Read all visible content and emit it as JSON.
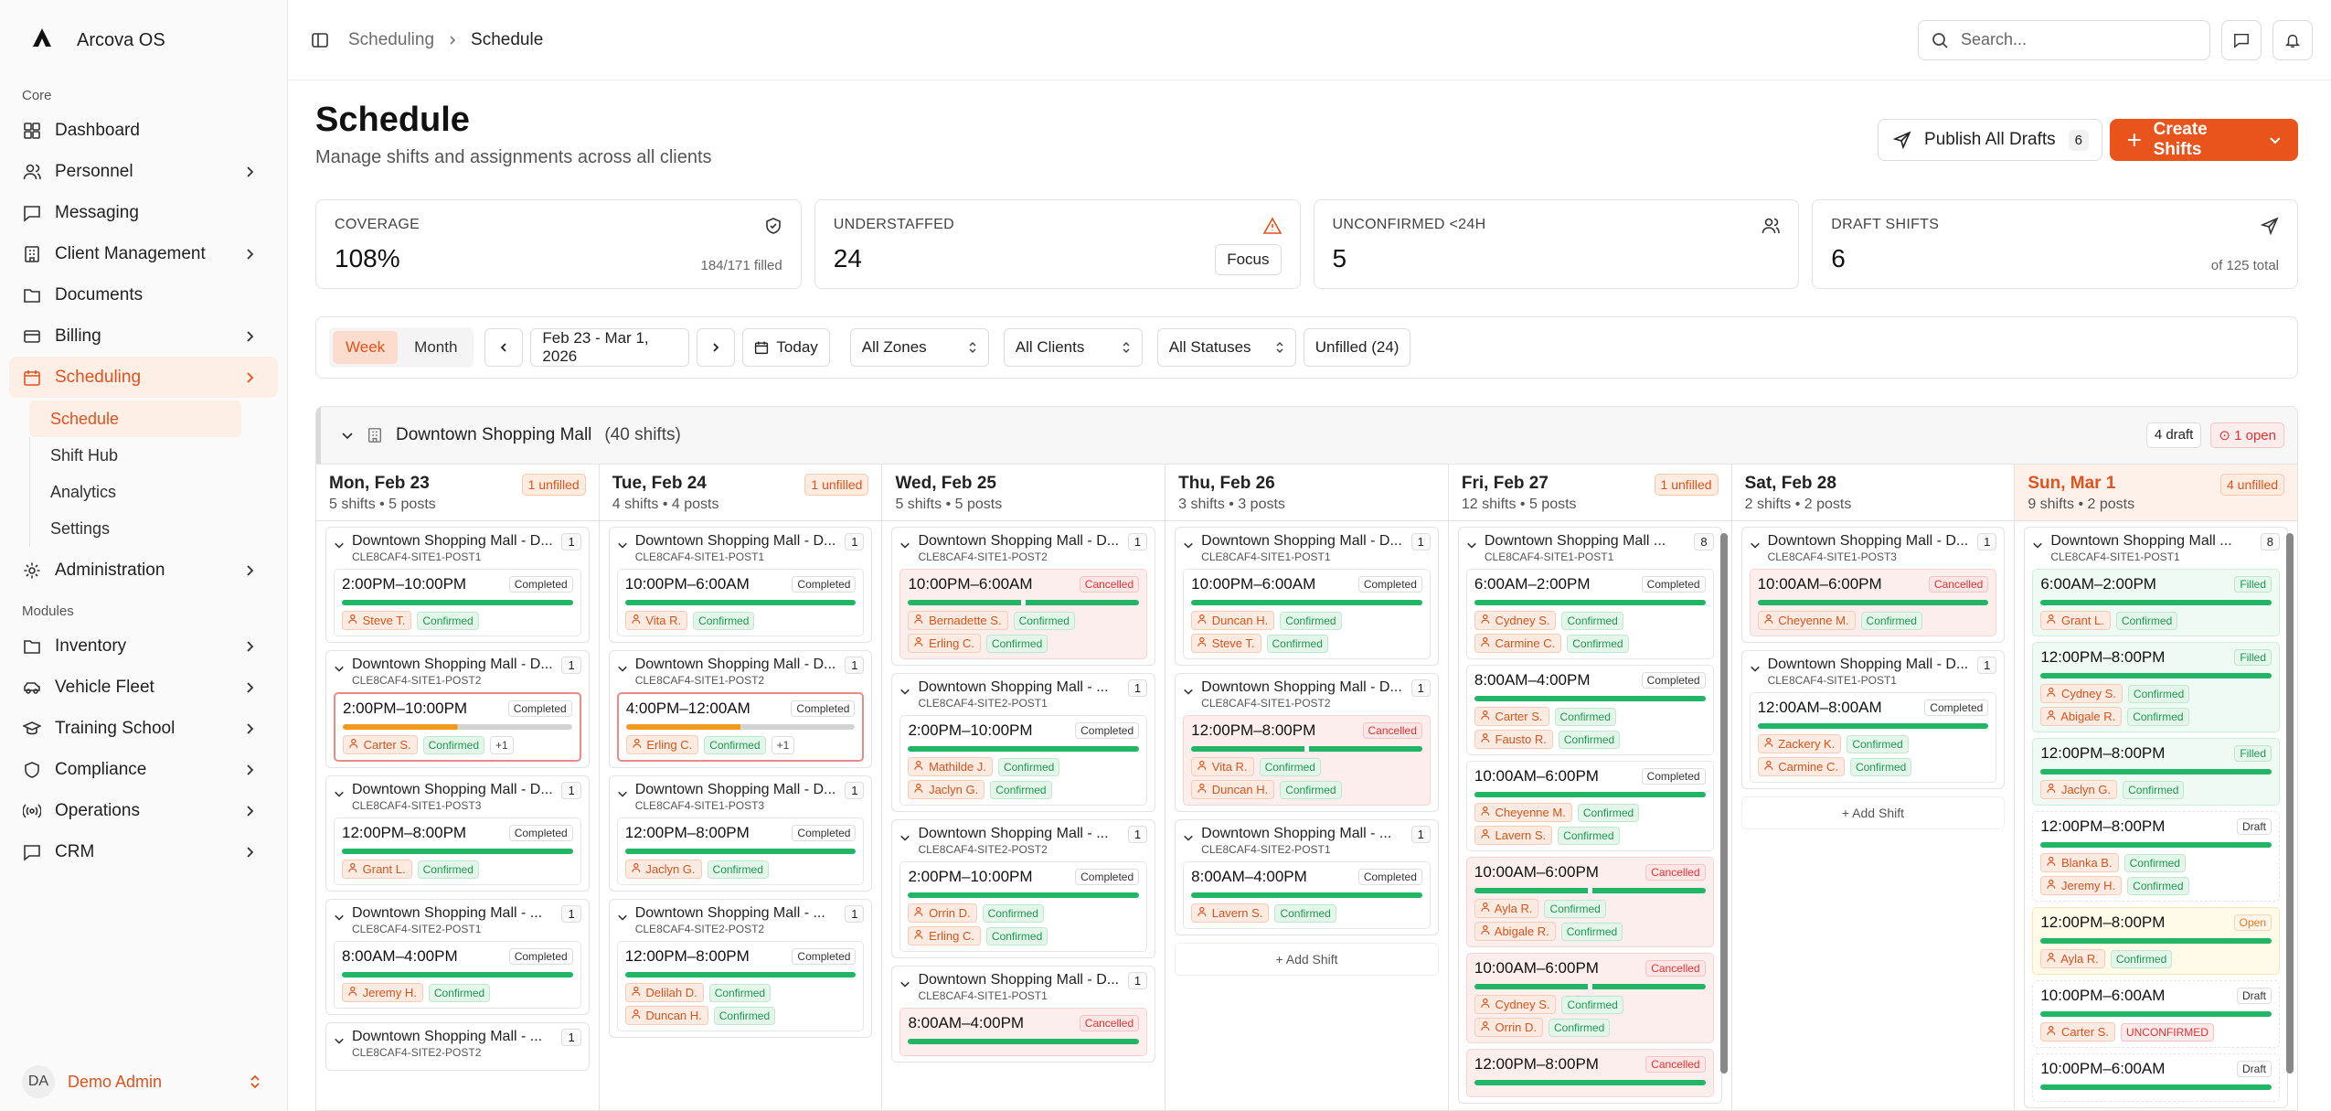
{
  "app": {
    "name": "Arcova OS"
  },
  "sidebar": {
    "core_label": "Core",
    "modules_label": "Modules",
    "core": [
      {
        "label": "Dashboard",
        "icon": "dashboard-icon"
      },
      {
        "label": "Personnel",
        "icon": "users-icon"
      },
      {
        "label": "Messaging",
        "icon": "message-icon"
      },
      {
        "label": "Client Management",
        "icon": "building-icon"
      },
      {
        "label": "Documents",
        "icon": "folder-icon"
      },
      {
        "label": "Billing",
        "icon": "card-icon"
      },
      {
        "label": "Scheduling",
        "icon": "calendar-icon"
      }
    ],
    "scheduling_sub": [
      "Schedule",
      "Shift Hub",
      "Analytics",
      "Settings"
    ],
    "admin": {
      "label": "Administration",
      "icon": "gear-icon"
    },
    "modules": [
      {
        "label": "Inventory",
        "icon": "folder-icon"
      },
      {
        "label": "Vehicle Fleet",
        "icon": "car-icon"
      },
      {
        "label": "Training School",
        "icon": "graduation-icon"
      },
      {
        "label": "Compliance",
        "icon": "shield-icon"
      },
      {
        "label": "Operations",
        "icon": "radio-icon"
      },
      {
        "label": "CRM",
        "icon": "message-icon"
      }
    ],
    "user": {
      "initials": "DA",
      "name": "Demo Admin"
    }
  },
  "topbar": {
    "crumb1": "Scheduling",
    "crumb2": "Schedule",
    "search_placeholder": "Search..."
  },
  "page": {
    "title": "Schedule",
    "subtitle": "Manage shifts and assignments across all clients",
    "publish_label": "Publish All Drafts",
    "publish_count": "6",
    "create_label": "Create Shifts"
  },
  "stats": [
    {
      "label": "COVERAGE",
      "value": "108%",
      "note": "184/171 filled"
    },
    {
      "label": "UNDERSTAFFED",
      "value": "24",
      "action": "Focus"
    },
    {
      "label": "UNCONFIRMED <24H",
      "value": "5"
    },
    {
      "label": "DRAFT SHIFTS",
      "value": "6",
      "note": "of 125 total"
    }
  ],
  "toolbar": {
    "week": "Week",
    "month": "Month",
    "range": "Feb 23 - Mar 1, 2026",
    "today": "Today",
    "zones": "All Zones",
    "clients": "All Clients",
    "statuses": "All Statuses",
    "unfilled": "Unfilled (24)"
  },
  "group": {
    "name": "Downtown Shopping Mall",
    "count": "(40 shifts)",
    "draft": "4 draft",
    "open": "1 open"
  },
  "days": [
    {
      "name": "Mon, Feb 23",
      "sub": "5 shifts • 5 posts",
      "unfilled": "1 unfilled"
    },
    {
      "name": "Tue, Feb 24",
      "sub": "4 shifts • 4 posts",
      "unfilled": "1 unfilled"
    },
    {
      "name": "Wed, Feb 25",
      "sub": "5 shifts • 5 posts",
      "unfilled": ""
    },
    {
      "name": "Thu, Feb 26",
      "sub": "3 shifts • 3 posts",
      "unfilled": ""
    },
    {
      "name": "Fri, Feb 27",
      "sub": "12 shifts • 5 posts",
      "unfilled": "1 unfilled"
    },
    {
      "name": "Sat, Feb 28",
      "sub": "2 shifts • 2 posts",
      "unfilled": ""
    },
    {
      "name": "Sun, Mar 1",
      "sub": "9 shifts • 2 posts",
      "unfilled": "4 unfilled"
    }
  ],
  "labels": {
    "add_shift": "+ Add Shift",
    "confirmed": "Confirmed",
    "unconfirmed": "UNCONFIRMED"
  },
  "columns": [
    [
      {
        "title": "Downtown Shopping Mall - D...",
        "code": "CLE8CAF4-SITE1-POST1",
        "n": "1",
        "shifts": [
          {
            "time": "2:00PM–10:00PM",
            "status": "Completed",
            "people": [
              "Steve T."
            ]
          }
        ]
      },
      {
        "title": "Downtown Shopping Mall - D...",
        "code": "CLE8CAF4-SITE1-POST2",
        "n": "1",
        "shifts": [
          {
            "time": "2:00PM–10:00PM",
            "status": "Completed",
            "people": [
              "Carter S."
            ],
            "more": "+1",
            "alert": true
          }
        ]
      },
      {
        "title": "Downtown Shopping Mall - D...",
        "code": "CLE8CAF4-SITE1-POST3",
        "n": "1",
        "shifts": [
          {
            "time": "12:00PM–8:00PM",
            "status": "Completed",
            "people": [
              "Grant L."
            ]
          }
        ]
      },
      {
        "title": "Downtown Shopping Mall - ...",
        "code": "CLE8CAF4-SITE2-POST1",
        "n": "1",
        "shifts": [
          {
            "time": "8:00AM–4:00PM",
            "status": "Completed",
            "people": [
              "Jeremy H."
            ]
          }
        ]
      },
      {
        "title": "Downtown Shopping Mall - ...",
        "code": "CLE8CAF4-SITE2-POST2",
        "n": "1",
        "shifts": []
      }
    ],
    [
      {
        "title": "Downtown Shopping Mall - D...",
        "code": "CLE8CAF4-SITE1-POST1",
        "n": "1",
        "shifts": [
          {
            "time": "10:00PM–6:00AM",
            "status": "Completed",
            "people": [
              "Vita R."
            ]
          }
        ]
      },
      {
        "title": "Downtown Shopping Mall - D...",
        "code": "CLE8CAF4-SITE1-POST2",
        "n": "1",
        "shifts": [
          {
            "time": "4:00PM–12:00AM",
            "status": "Completed",
            "people": [
              "Erling C."
            ],
            "more": "+1",
            "alert": true
          }
        ]
      },
      {
        "title": "Downtown Shopping Mall - D...",
        "code": "CLE8CAF4-SITE1-POST3",
        "n": "1",
        "shifts": [
          {
            "time": "12:00PM–8:00PM",
            "status": "Completed",
            "people": [
              "Jaclyn G."
            ]
          }
        ]
      },
      {
        "title": "Downtown Shopping Mall - ...",
        "code": "CLE8CAF4-SITE2-POST2",
        "n": "1",
        "shifts": [
          {
            "time": "12:00PM–8:00PM",
            "status": "Completed",
            "people": [
              "Delilah D.",
              "Duncan H."
            ]
          }
        ]
      }
    ],
    [
      {
        "title": "Downtown Shopping Mall - D...",
        "code": "CLE8CAF4-SITE1-POST2",
        "n": "1",
        "shifts": [
          {
            "time": "10:00PM–6:00AM",
            "status": "Cancelled",
            "people": [
              "Bernadette S.",
              "Erling C."
            ]
          }
        ]
      },
      {
        "title": "Downtown Shopping Mall - ...",
        "code": "CLE8CAF4-SITE2-POST1",
        "n": "1",
        "shifts": [
          {
            "time": "2:00PM–10:00PM",
            "status": "Completed",
            "people": [
              "Mathilde J.",
              "Jaclyn G."
            ]
          }
        ]
      },
      {
        "title": "Downtown Shopping Mall - ...",
        "code": "CLE8CAF4-SITE2-POST2",
        "n": "1",
        "shifts": [
          {
            "time": "2:00PM–10:00PM",
            "status": "Completed",
            "people": [
              "Orrin D.",
              "Erling C."
            ]
          }
        ]
      },
      {
        "title": "Downtown Shopping Mall - D...",
        "code": "CLE8CAF4-SITE1-POST1",
        "n": "1",
        "shifts": [
          {
            "time": "8:00AM–4:00PM",
            "status": "Cancelled",
            "people": []
          }
        ]
      }
    ],
    [
      {
        "title": "Downtown Shopping Mall - D...",
        "code": "CLE8CAF4-SITE1-POST1",
        "n": "1",
        "shifts": [
          {
            "time": "10:00PM–6:00AM",
            "status": "Completed",
            "people": [
              "Duncan H.",
              "Steve T."
            ]
          }
        ]
      },
      {
        "title": "Downtown Shopping Mall - D...",
        "code": "CLE8CAF4-SITE1-POST2",
        "n": "1",
        "shifts": [
          {
            "time": "12:00PM–8:00PM",
            "status": "Cancelled",
            "people": [
              "Vita R.",
              "Duncan H."
            ]
          }
        ]
      },
      {
        "title": "Downtown Shopping Mall - ...",
        "code": "CLE8CAF4-SITE2-POST1",
        "n": "1",
        "shifts": [
          {
            "time": "8:00AM–4:00PM",
            "status": "Completed",
            "people": [
              "Lavern S."
            ]
          }
        ]
      },
      {
        "add": true
      }
    ],
    [
      {
        "title": "Downtown Shopping Mall ...",
        "code": "CLE8CAF4-SITE1-POST1",
        "n": "8",
        "shifts": [
          {
            "time": "6:00AM–2:00PM",
            "status": "Completed",
            "people": [
              "Cydney S.",
              "Carmine C."
            ]
          },
          {
            "time": "8:00AM–4:00PM",
            "status": "Completed",
            "people": [
              "Carter S.",
              "Fausto R."
            ]
          },
          {
            "time": "10:00AM–6:00PM",
            "status": "Completed",
            "people": [
              "Cheyenne M.",
              "Lavern S."
            ]
          },
          {
            "time": "10:00AM–6:00PM",
            "status": "Cancelled",
            "people": [
              "Ayla R.",
              "Abigale R."
            ]
          },
          {
            "time": "10:00AM–6:00PM",
            "status": "Cancelled",
            "people": [
              "Cydney S.",
              "Orrin D."
            ]
          },
          {
            "time": "12:00PM–8:00PM",
            "status": "Cancelled",
            "people": []
          }
        ]
      }
    ],
    [
      {
        "title": "Downtown Shopping Mall - D...",
        "code": "CLE8CAF4-SITE1-POST3",
        "n": "1",
        "shifts": [
          {
            "time": "10:00AM–6:00PM",
            "status": "Cancelled",
            "people": [
              "Cheyenne M."
            ]
          }
        ]
      },
      {
        "title": "Downtown Shopping Mall - D...",
        "code": "CLE8CAF4-SITE1-POST1",
        "n": "1",
        "shifts": [
          {
            "time": "12:00AM–8:00AM",
            "status": "Completed",
            "people": [
              "Zackery K.",
              "Carmine C."
            ]
          }
        ]
      },
      {
        "add": true
      }
    ],
    [
      {
        "title": "Downtown Shopping Mall ...",
        "code": "CLE8CAF4-SITE1-POST1",
        "n": "8",
        "shifts": [
          {
            "time": "6:00AM–2:00PM",
            "status": "Filled",
            "people": [
              "Grant L."
            ]
          },
          {
            "time": "12:00PM–8:00PM",
            "status": "Filled",
            "people": [
              "Cydney S.",
              "Abigale R."
            ]
          },
          {
            "time": "12:00PM–8:00PM",
            "status": "Filled",
            "people": [
              "Jaclyn G."
            ]
          },
          {
            "time": "12:00PM–8:00PM",
            "status": "Draft",
            "people": [
              "Blanka B.",
              "Jeremy H."
            ]
          },
          {
            "time": "12:00PM–8:00PM",
            "status": "Open",
            "people": [
              "Ayla R."
            ]
          },
          {
            "time": "10:00PM–6:00AM",
            "status": "Draft",
            "people": [
              "Carter S."
            ],
            "unconfirmed": true
          },
          {
            "time": "10:00PM–6:00AM",
            "status": "Draft",
            "people": []
          }
        ]
      }
    ]
  ]
}
